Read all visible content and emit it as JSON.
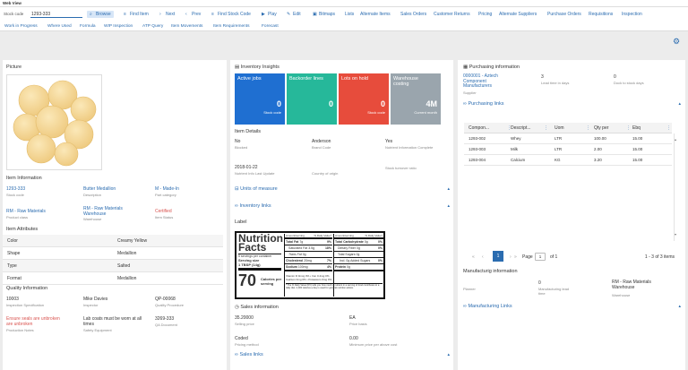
{
  "window": {
    "title": "Web View"
  },
  "toolbar": {
    "stock_code_label": "Stock code",
    "stock_code_value": "1293-333",
    "buttons": [
      "Browse",
      "Find Item",
      "Next",
      "Prev",
      "Find Stock Code",
      "Play",
      "Edit",
      "Bitmaps",
      "Lists",
      "Alternate Items",
      "Sales Orders",
      "Customer Returns",
      "Pricing",
      "Alternate Suppliers",
      "Purchase Orders",
      "Requisitions",
      "Inspection"
    ],
    "links": [
      "Work in Progress",
      "Where Used",
      "Formula",
      "WIP Inspection",
      "ATP Query",
      "Item Movements",
      "Item Requirements",
      "Forecast"
    ]
  },
  "left": {
    "picture_title": "Picture",
    "item_info_title": "Item Information",
    "item_info": [
      {
        "value": "1293-333",
        "caption": "Stock code",
        "style": "link"
      },
      {
        "value": "Butter Medallion",
        "caption": "Description",
        "style": "link"
      },
      {
        "value": "M - Made-In",
        "caption": "Part category",
        "style": "link"
      },
      {
        "value": "RM - Raw Materials",
        "caption": "Product class",
        "style": "link"
      },
      {
        "value": "RM - Raw Materials Warehouse",
        "caption": "Warehouse",
        "style": "link"
      },
      {
        "value": "Certified",
        "caption": "Item Status",
        "style": "red"
      }
    ],
    "attributes_title": "Item Attributes",
    "attributes": [
      {
        "name": "Color",
        "value": "Creamy Yellow"
      },
      {
        "name": "Shape",
        "value": "Medallion"
      },
      {
        "name": "Type",
        "value": "Salted"
      },
      {
        "name": "Format",
        "value": "Medallion"
      }
    ],
    "quality_title": "Quality Information",
    "quality": [
      {
        "value": "10003",
        "caption": "Inspection Specification",
        "style": "plain"
      },
      {
        "value": "Mike Davies",
        "caption": "Inspector",
        "style": "plain"
      },
      {
        "value": "QP-00068",
        "caption": "Quality Procedure",
        "style": "plain"
      },
      {
        "value": "Ensure seals are unbroken\nare unbroken",
        "caption": "Production Notes",
        "style": "red"
      },
      {
        "value": "Lab coats must be worn at all times",
        "caption": "Safety Equipment",
        "style": "plain"
      },
      {
        "value": "3269-333",
        "caption": "QA Document",
        "style": "plain"
      }
    ]
  },
  "middle": {
    "insights_title": "Inventory Insights",
    "tiles": [
      {
        "title": "Active jobs",
        "number": "0",
        "caption": "Stock code",
        "color": "#1f6fd1"
      },
      {
        "title": "Backorder lines",
        "number": "0",
        "caption": "",
        "color": "#26b89a"
      },
      {
        "title": "Lots on hold",
        "number": "0",
        "caption": "Stock code",
        "color": "#e74c3c"
      },
      {
        "title": "Warehouse costing",
        "number": "4M",
        "caption": "Current month",
        "color": "#9aa5ad"
      }
    ],
    "details_title": "Item Details",
    "details": [
      {
        "value": "No",
        "caption": "Blocked"
      },
      {
        "value": "Anderson",
        "caption": "Brand Code"
      },
      {
        "value": "Yes",
        "caption": "Nutrient Information Complete"
      },
      {
        "value": "2018-01-22",
        "caption": "Nutrient Info Last Update"
      },
      {
        "value": "",
        "caption": "Country of origin"
      },
      {
        "value": "",
        "caption": "Stock turnover ratio"
      }
    ],
    "units_title": "Units of measure",
    "inv_links_title": "Inventory links",
    "label_title": "Label",
    "nutrition": {
      "head": "Nutrition Facts",
      "servings": "5 servings per container",
      "serving_size_label": "Serving size",
      "serving_size_value": "1 TBSP (14g)",
      "calories_amount": "70",
      "calories_label": "Calories per serving",
      "col1_head": "Amount/serving",
      "col1_pct": "% Daily Value*",
      "rows_left": [
        {
          "name": "Total Fat",
          "amt": "7g",
          "dv": "9%"
        },
        {
          "name": "Saturated Fat",
          "amt": "3.5g",
          "dv": "18%"
        },
        {
          "name": "Trans Fat",
          "amt": "0g",
          "dv": ""
        },
        {
          "name": "Cholesterol",
          "amt": "20mg",
          "dv": "7%"
        },
        {
          "name": "Sodium",
          "amt": "100mg",
          "dv": "4%"
        }
      ],
      "rows_right": [
        {
          "name": "Total Carbohydrate",
          "amt": "0g",
          "dv": "0%"
        },
        {
          "name": "Dietary Fiber",
          "amt": "0g",
          "dv": "0%"
        },
        {
          "name": "Total Sugars",
          "amt": "0g",
          "dv": ""
        },
        {
          "name": "Incl. 0g Added Sugars",
          "amt": "",
          "dv": "0%"
        },
        {
          "name": "Protein",
          "amt": "0g",
          "dv": ""
        }
      ],
      "vitamins": "Vitamin D 0mcg 0% • Iron 0.4mg 0%\nCalcium 0mg 0% • Potassium 0mg 0%",
      "footnote": "* The % Daily Value (DV) tells you how much a nutrient in a serving of food contributes to a daily diet. 2,000 calories a day is used for general nutrition advice."
    },
    "sales_title": "Sales information",
    "sales": [
      {
        "value": "35.20000",
        "caption": "Selling price"
      },
      {
        "value": "EA",
        "caption": "Price basis"
      },
      {
        "value": "Coded",
        "caption": "Pricing method"
      },
      {
        "value": "0.00",
        "caption": "Minimum price per above cost"
      }
    ],
    "sales_links_title": "Sales links"
  },
  "right": {
    "purchasing_title": "Purchasing information",
    "purchasing": [
      {
        "value": "0000001 - Aztech Component Manufacturers",
        "caption": "Supplier",
        "style": "link"
      },
      {
        "value": "3",
        "caption": "Lead time in days",
        "style": "plain"
      },
      {
        "value": "0",
        "caption": "Dock to stock days",
        "style": "plain"
      }
    ],
    "purchasing_links_title": "Purchasing links",
    "grid": {
      "headers": [
        "Compon...",
        "Descript...",
        "Uom",
        "Qty per",
        "Ebq"
      ],
      "rows": [
        [
          "1293-002",
          "Whey",
          "LTR",
          "100.00",
          "15.00"
        ],
        [
          "1293-003",
          "Milk",
          "LTR",
          "2.00",
          "15.00"
        ],
        [
          "1293-004",
          "Calcium",
          "KG",
          "3.20",
          "15.00"
        ]
      ],
      "page_label": "Page",
      "page_value": "1",
      "of_label": "of 1",
      "current_page": "1",
      "items_summary": "1 - 3 of 3 items"
    },
    "manufacturing_title": "Manufacturig information",
    "manufacturing": [
      {
        "value": "",
        "caption": "Planner"
      },
      {
        "value": "0",
        "caption": "Manufacturing lead time"
      },
      {
        "value": "RM - Raw Materials Warehouse",
        "caption": "Warehouse"
      }
    ],
    "mfg_links_title": "Manufacturing Links"
  }
}
